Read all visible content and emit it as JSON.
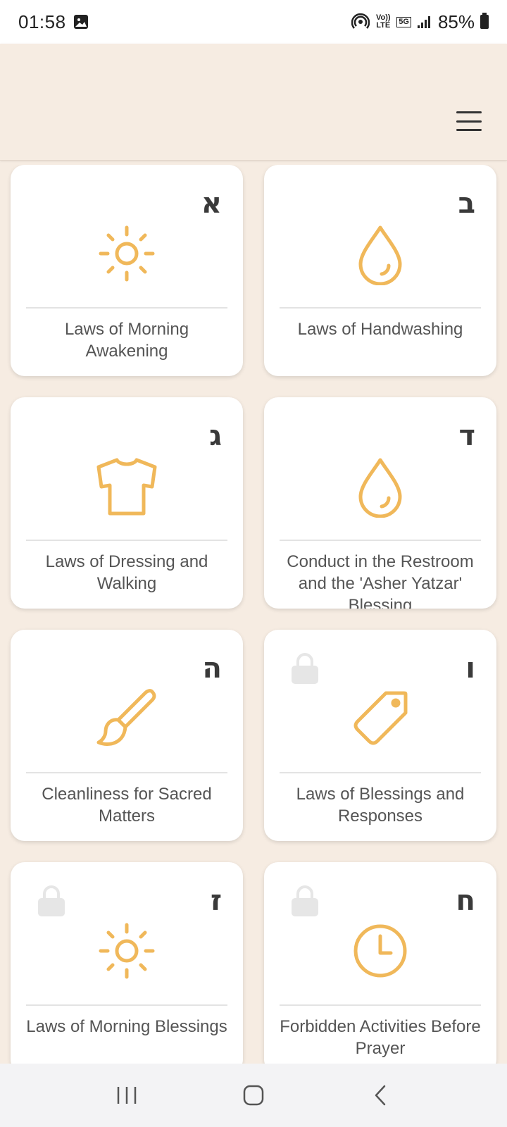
{
  "status_bar": {
    "time": "01:58",
    "network_top": "Vo)) LTE",
    "network_5g": "5G",
    "battery": "85%"
  },
  "colors": {
    "accent": "#f0b85a",
    "background": "#f6ece2",
    "card": "#ffffff",
    "lock": "#e6e6e6"
  },
  "cards": [
    {
      "letter": "א",
      "label": "Laws of Morning Awakening",
      "icon": "sun-icon",
      "locked": false
    },
    {
      "letter": "ב",
      "label": "Laws of Handwashing",
      "icon": "water-drop-icon",
      "locked": false
    },
    {
      "letter": "ג",
      "label": "Laws of Dressing and Walking",
      "icon": "shirt-icon",
      "locked": false
    },
    {
      "letter": "ד",
      "label": "Conduct in the Restroom and the 'Asher Yatzar' Blessing",
      "icon": "water-drop-icon",
      "locked": false
    },
    {
      "letter": "ה",
      "label": "Cleanliness for Sacred Matters",
      "icon": "paintbrush-icon",
      "locked": false
    },
    {
      "letter": "ו",
      "label": "Laws of Blessings and Responses",
      "icon": "tag-icon",
      "locked": true
    },
    {
      "letter": "ז",
      "label": "Laws of Morning Blessings",
      "icon": "sun-icon",
      "locked": true
    },
    {
      "letter": "ח",
      "label": "Forbidden Activities Before Prayer",
      "icon": "clock-icon",
      "locked": true
    }
  ],
  "navigation": {
    "recents": "recent-apps-icon",
    "home": "home-icon",
    "back": "back-icon"
  }
}
